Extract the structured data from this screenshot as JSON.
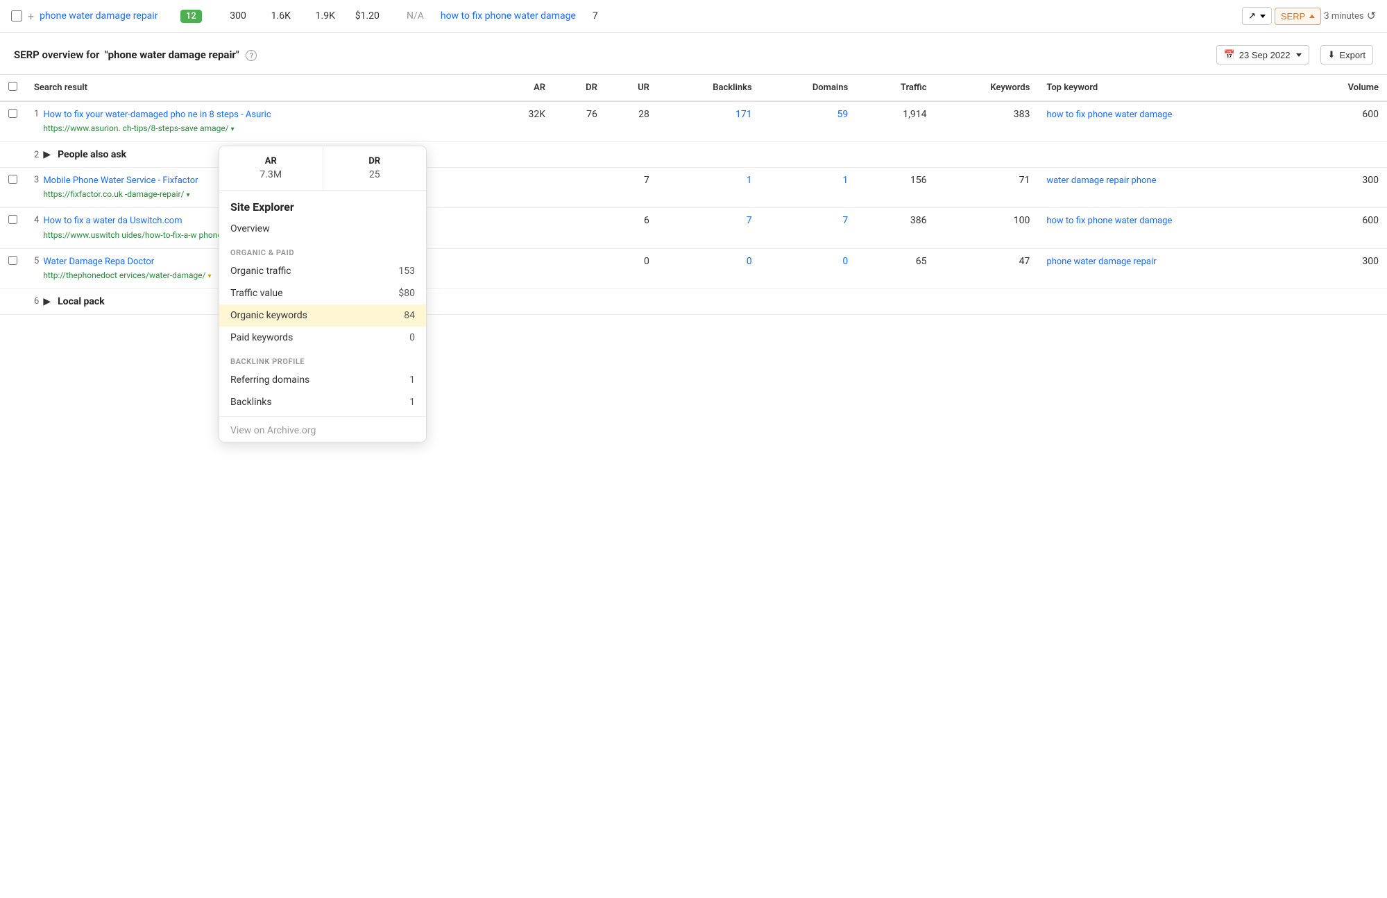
{
  "keyword_row": {
    "keyword": "phone water damage repair",
    "badge": "12",
    "stats": {
      "s1": "300",
      "s2": "1.6K",
      "s3": "1.9K",
      "price": "$1.20",
      "na": "N/A"
    },
    "top_keyword": "how to fix phone water damage",
    "position": "7",
    "trend_label": "▲",
    "serp_label": "SERP ▲",
    "time": "3 minutes",
    "refresh_icon": "↺"
  },
  "serp_overview": {
    "title": "SERP overview for",
    "query": "phone water damage repair",
    "help": "?",
    "date": "23 Sep 2022",
    "export_label": "Export"
  },
  "table": {
    "columns": [
      "Search result",
      "AR",
      "DR",
      "UR",
      "Backlinks",
      "Domains",
      "Traffic",
      "Keywords",
      "Top keyword",
      "Volume"
    ],
    "rows": [
      {
        "num": "1",
        "title": "How to fix your water-damaged pho ne in 8 steps - Asuric",
        "url": "https://www.asurion. ch-tips/8-steps-save amage/",
        "has_arrow": true,
        "ar": "32K",
        "dr": "76",
        "ur": "28",
        "backlinks": "171",
        "domains": "59",
        "traffic": "1,914",
        "keywords": "383",
        "top_keyword": "how to fix phone water damage",
        "volume": "600"
      },
      {
        "num": "2",
        "is_people": true,
        "title": "People also ask",
        "url": "",
        "ar": "",
        "dr": "",
        "ur": "",
        "backlinks": "",
        "domains": "",
        "traffic": "",
        "keywords": "",
        "top_keyword": "",
        "volume": ""
      },
      {
        "num": "3",
        "title": "Mobile Phone Water Service - Fixfactor",
        "url": "https://fixfactor.co.uk -damage-repair/",
        "has_arrow": true,
        "ar": "",
        "dr": "",
        "ur": "7",
        "backlinks": "1",
        "domains": "1",
        "traffic": "156",
        "keywords": "71",
        "top_keyword": "water damage repair phone",
        "volume": "300"
      },
      {
        "num": "4",
        "title": "How to fix a water da Uswitch.com",
        "url": "https://www.uswitch uides/how-to-fix-a-w phone/",
        "has_arrow": true,
        "ar": "",
        "dr": "",
        "ur": "6",
        "backlinks": "7",
        "domains": "7",
        "traffic": "386",
        "keywords": "100",
        "top_keyword": "how to fix phone water damage",
        "volume": "600"
      },
      {
        "num": "5",
        "title": "Water Damage Repa Doctor",
        "url": "http://thephonedoct ervices/water-damage/",
        "has_arrow": true,
        "has_yellow_arrow": true,
        "ar": "",
        "dr": "",
        "ur": "0",
        "backlinks": "0",
        "domains": "0",
        "traffic": "65",
        "keywords": "47",
        "top_keyword": "phone water damage repair",
        "volume": "300"
      },
      {
        "num": "6",
        "is_local": true,
        "title": "Local pack",
        "url": "",
        "ar": "",
        "dr": "",
        "ur": "",
        "backlinks": "",
        "domains": "",
        "traffic": "",
        "keywords": "",
        "top_keyword": "",
        "volume": ""
      }
    ]
  },
  "popup": {
    "ar_label": "AR",
    "ar_value": "7.3M",
    "dr_label": "DR",
    "dr_value": "25",
    "site_explorer_title": "Site Explorer",
    "overview_label": "Overview",
    "organic_paid_label": "ORGANIC & PAID",
    "organic_traffic_label": "Organic traffic",
    "organic_traffic_value": "153",
    "traffic_value_label": "Traffic value",
    "traffic_value_value": "$80",
    "organic_keywords_label": "Organic keywords",
    "organic_keywords_value": "84",
    "paid_keywords_label": "Paid keywords",
    "paid_keywords_value": "0",
    "backlink_profile_label": "BACKLINK PROFILE",
    "referring_domains_label": "Referring domains",
    "referring_domains_value": "1",
    "backlinks_label": "Backlinks",
    "backlinks_value": "1",
    "archive_label": "View on Archive.org"
  }
}
